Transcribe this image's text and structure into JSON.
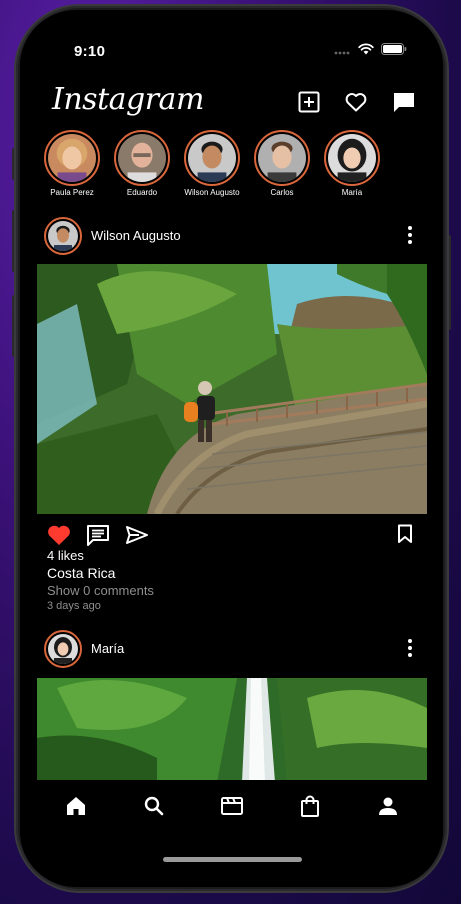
{
  "status_bar": {
    "time": "9:10"
  },
  "header": {
    "logo": "Instagram",
    "icons": [
      "add-post-icon",
      "heart-icon",
      "messages-icon"
    ]
  },
  "stories": [
    {
      "name": "Paula Perez"
    },
    {
      "name": "Eduardo"
    },
    {
      "name": "Wilson Augusto"
    },
    {
      "name": "Carlos"
    },
    {
      "name": "María"
    }
  ],
  "posts": [
    {
      "user": "Wilson Augusto",
      "likes": "4 likes",
      "caption": "Costa Rica",
      "comments": "Show 0 comments",
      "time_ago": "3 days ago",
      "liked": true
    },
    {
      "user": "María"
    }
  ],
  "tab_bar": {
    "tabs": [
      "home-icon",
      "search-icon",
      "reels-icon",
      "shop-icon",
      "profile-icon"
    ],
    "active": "home"
  },
  "colors": {
    "accent_ring": "#d9673b",
    "like_red": "#ff3b30",
    "muted_text": "#8e8e8e"
  }
}
